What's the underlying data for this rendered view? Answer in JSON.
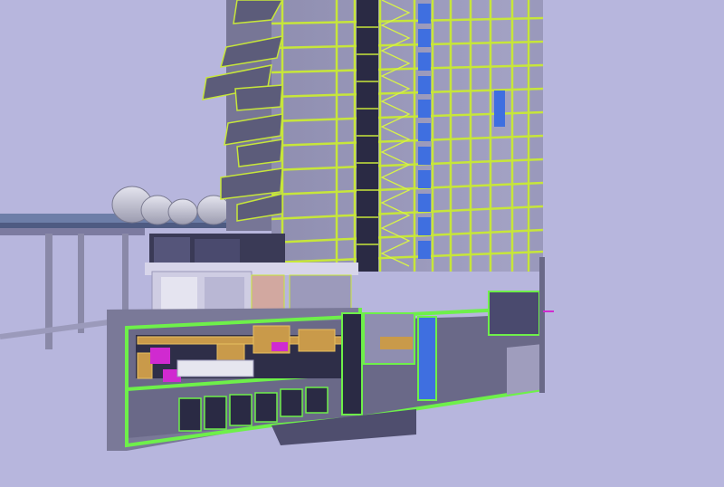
{
  "viewer": {
    "model_view": "bim-building-section-3d",
    "background_color": "#b7b6dd",
    "section_cut_color": "#6ef04a",
    "edge_highlight_color": "#d8f24a",
    "glazing_color": "#3f6fe0",
    "structure_color": "#8c8aa8",
    "mechanical_duct_color": "#c99a4a",
    "piping_magenta_color": "#d02ad0",
    "shaft_dark_color": "#23233a"
  },
  "elements": {
    "icons": [
      "balcony-icon",
      "dome-tank-icon",
      "column-icon"
    ]
  }
}
